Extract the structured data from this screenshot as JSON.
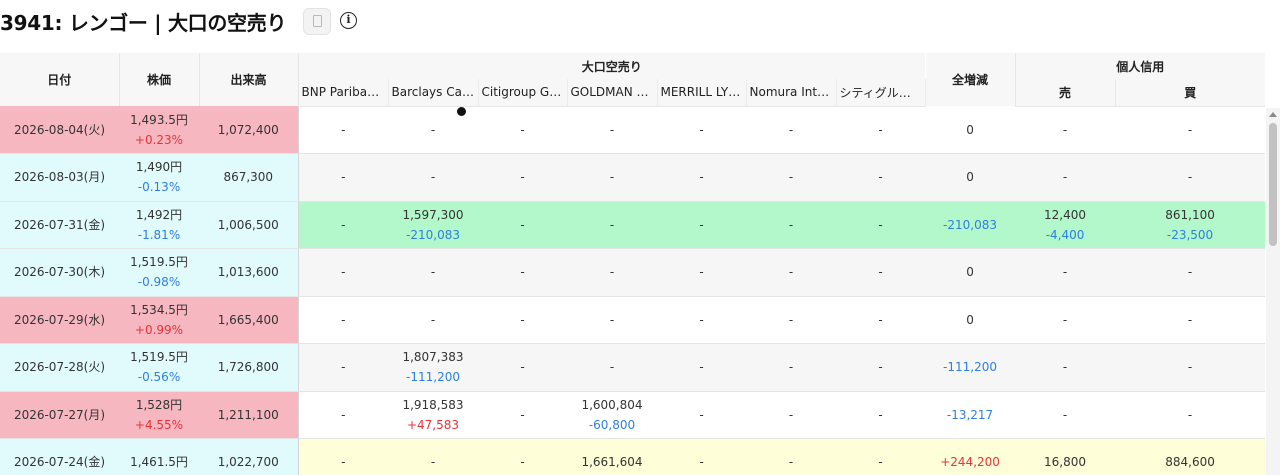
{
  "page": {
    "title": "3941: レンゴー | 大口の空売り",
    "copy_icon": "document-icon",
    "info_icon": "info-circle-icon",
    "info_glyph": "i"
  },
  "table": {
    "headers": {
      "date": "日付",
      "price": "株価",
      "volume": "出来高",
      "large_short_group": "大口空売り",
      "total_change": "全増減",
      "margin_group": "個人信用",
      "sell": "売",
      "buy": "買"
    },
    "brokers": [
      "BNP Paribas Arbitrage",
      "Barclays Capital",
      "Citigroup Global",
      "GOLDMAN SACHS",
      "MERRILL LYNCH",
      "Nomura International",
      "シティグループ"
    ],
    "rows": [
      {
        "date": "2026-08-04(火)",
        "price": "1,493.5円",
        "price_change": "+0.23%",
        "volume": "1,072,400",
        "brokers": [
          {
            "v": "-",
            "c": ""
          },
          {
            "v": "-",
            "c": ""
          },
          {
            "v": "-",
            "c": ""
          },
          {
            "v": "-",
            "c": ""
          },
          {
            "v": "-",
            "c": ""
          },
          {
            "v": "-",
            "c": ""
          },
          {
            "v": "-",
            "c": ""
          }
        ],
        "total": "0",
        "sell": {
          "v": "-",
          "c": ""
        },
        "buy": {
          "v": "-",
          "c": ""
        }
      },
      {
        "date": "2026-08-03(月)",
        "price": "1,490円",
        "price_change": "-0.13%",
        "volume": "867,300",
        "brokers": [
          {
            "v": "-",
            "c": ""
          },
          {
            "v": "-",
            "c": ""
          },
          {
            "v": "-",
            "c": ""
          },
          {
            "v": "-",
            "c": ""
          },
          {
            "v": "-",
            "c": ""
          },
          {
            "v": "-",
            "c": ""
          },
          {
            "v": "-",
            "c": ""
          }
        ],
        "total": "0",
        "sell": {
          "v": "-",
          "c": ""
        },
        "buy": {
          "v": "-",
          "c": ""
        }
      },
      {
        "date": "2026-07-31(金)",
        "price": "1,492円",
        "price_change": "-1.81%",
        "volume": "1,006,500",
        "brokers": [
          {
            "v": "-",
            "c": ""
          },
          {
            "v": "1,597,300",
            "c": "-210,083"
          },
          {
            "v": "-",
            "c": ""
          },
          {
            "v": "-",
            "c": ""
          },
          {
            "v": "-",
            "c": ""
          },
          {
            "v": "-",
            "c": ""
          },
          {
            "v": "-",
            "c": ""
          }
        ],
        "total": "-210,083",
        "sell": {
          "v": "12,400",
          "c": "-4,400"
        },
        "buy": {
          "v": "861,100",
          "c": "-23,500"
        }
      },
      {
        "date": "2026-07-30(木)",
        "price": "1,519.5円",
        "price_change": "-0.98%",
        "volume": "1,013,600",
        "brokers": [
          {
            "v": "-",
            "c": ""
          },
          {
            "v": "-",
            "c": ""
          },
          {
            "v": "-",
            "c": ""
          },
          {
            "v": "-",
            "c": ""
          },
          {
            "v": "-",
            "c": ""
          },
          {
            "v": "-",
            "c": ""
          },
          {
            "v": "-",
            "c": ""
          }
        ],
        "total": "0",
        "sell": {
          "v": "-",
          "c": ""
        },
        "buy": {
          "v": "-",
          "c": ""
        }
      },
      {
        "date": "2026-07-29(水)",
        "price": "1,534.5円",
        "price_change": "+0.99%",
        "volume": "1,665,400",
        "brokers": [
          {
            "v": "-",
            "c": ""
          },
          {
            "v": "-",
            "c": ""
          },
          {
            "v": "-",
            "c": ""
          },
          {
            "v": "-",
            "c": ""
          },
          {
            "v": "-",
            "c": ""
          },
          {
            "v": "-",
            "c": ""
          },
          {
            "v": "-",
            "c": ""
          }
        ],
        "total": "0",
        "sell": {
          "v": "-",
          "c": ""
        },
        "buy": {
          "v": "-",
          "c": ""
        }
      },
      {
        "date": "2026-07-28(火)",
        "price": "1,519.5円",
        "price_change": "-0.56%",
        "volume": "1,726,800",
        "brokers": [
          {
            "v": "-",
            "c": ""
          },
          {
            "v": "1,807,383",
            "c": "-111,200"
          },
          {
            "v": "-",
            "c": ""
          },
          {
            "v": "-",
            "c": ""
          },
          {
            "v": "-",
            "c": ""
          },
          {
            "v": "-",
            "c": ""
          },
          {
            "v": "-",
            "c": ""
          }
        ],
        "total": "-111,200",
        "sell": {
          "v": "-",
          "c": ""
        },
        "buy": {
          "v": "-",
          "c": ""
        }
      },
      {
        "date": "2026-07-27(月)",
        "price": "1,528円",
        "price_change": "+4.55%",
        "volume": "1,211,100",
        "brokers": [
          {
            "v": "-",
            "c": ""
          },
          {
            "v": "1,918,583",
            "c": "+47,583"
          },
          {
            "v": "-",
            "c": ""
          },
          {
            "v": "1,600,804",
            "c": "-60,800"
          },
          {
            "v": "-",
            "c": ""
          },
          {
            "v": "-",
            "c": ""
          },
          {
            "v": "-",
            "c": ""
          }
        ],
        "total": "-13,217",
        "sell": {
          "v": "-",
          "c": ""
        },
        "buy": {
          "v": "-",
          "c": ""
        }
      },
      {
        "date": "2026-07-24(金)",
        "price": "1,461.5円",
        "price_change": "",
        "volume": "1,022,700",
        "brokers": [
          {
            "v": "-",
            "c": ""
          },
          {
            "v": "-",
            "c": ""
          },
          {
            "v": "-",
            "c": ""
          },
          {
            "v": "1,661,604",
            "c": ""
          },
          {
            "v": "-",
            "c": ""
          },
          {
            "v": "-",
            "c": ""
          },
          {
            "v": "-",
            "c": ""
          }
        ],
        "total": "+244,200",
        "sell": {
          "v": "16,800",
          "c": ""
        },
        "buy": {
          "v": "884,600",
          "c": ""
        }
      }
    ]
  },
  "colors": {
    "up": "#e8333a",
    "down": "#2f7fe0",
    "row_up": "#f7b7c1",
    "row_down": "#e1fbfc",
    "change_highlight": "#b2f8cb",
    "increase_highlight": "#fefed8"
  },
  "row_styles": [
    {
      "left": "red",
      "right": "white"
    },
    {
      "left": "cyan",
      "right": "grey"
    },
    {
      "left": "cyan",
      "right": "green"
    },
    {
      "left": "cyan",
      "right": "grey"
    },
    {
      "left": "red",
      "right": "white"
    },
    {
      "left": "cyan",
      "right": "grey"
    },
    {
      "left": "red",
      "right": "white"
    },
    {
      "left": "cyan",
      "right": "yellow"
    }
  ]
}
